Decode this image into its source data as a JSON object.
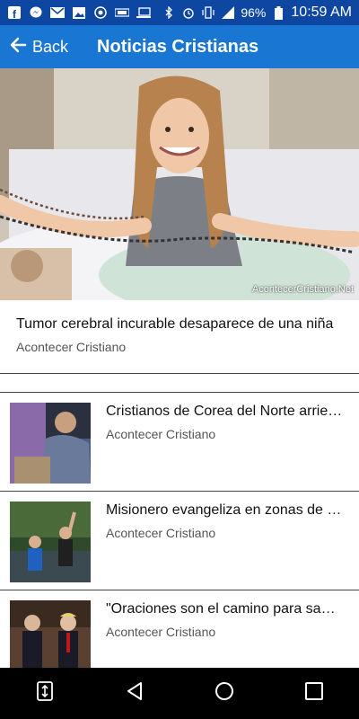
{
  "status_bar": {
    "battery": "96%",
    "time": "10:59 AM",
    "left_icons": [
      "facebook-icon",
      "messenger-icon",
      "mail-icon",
      "image-icon",
      "whatsapp-icon",
      "sim-icon",
      "laptop-icon"
    ],
    "right_icons": [
      "bluetooth-icon",
      "alarm-icon",
      "vibrate-icon",
      "signal-icon",
      "battery-icon"
    ]
  },
  "app_bar": {
    "back_label": "Back",
    "title": "Noticias Cristianas"
  },
  "hero": {
    "watermark": "AcontecerCristiano.Net"
  },
  "featured": {
    "title": "Tumor cerebral incurable desaparece de una niña",
    "source": "Acontecer Cristiano"
  },
  "articles": [
    {
      "title": "Cristianos de Corea del Norte arriesgan sus vidas",
      "source": "Acontecer Cristiano"
    },
    {
      "title": "Misionero evangeliza en zonas de conflicto",
      "source": "Acontecer Cristiano"
    },
    {
      "title": "\"Oraciones son el camino para sanar\"",
      "source": "Acontecer Cristiano"
    }
  ],
  "colors": {
    "status_bar": "#0d47a1",
    "app_bar": "#1976d2",
    "nav_bar": "#000000"
  }
}
